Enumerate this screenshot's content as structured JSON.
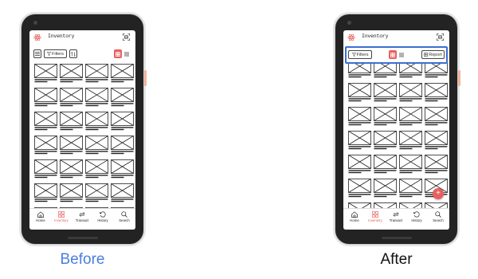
{
  "colors": {
    "accent": "#e85f5f",
    "highlight": "#3c6fd4",
    "caption_before": "#4a7fe0",
    "caption_after": "#111111"
  },
  "before": {
    "caption": "Before",
    "app_title": "Inventory",
    "toolbar": {
      "menu_icon": "menu-icon",
      "filters_label": "Filters",
      "sort_icon": "sort-icon",
      "grid_icon": "grid-view-icon",
      "list_icon": "list-view-icon"
    },
    "nav": [
      {
        "label": "Home",
        "icon": "home-icon"
      },
      {
        "label": "Inventory",
        "icon": "inventory-icon",
        "active": true
      },
      {
        "label": "Transact",
        "icon": "transact-icon"
      },
      {
        "label": "History",
        "icon": "history-icon"
      },
      {
        "label": "Search",
        "icon": "search-icon"
      }
    ]
  },
  "after": {
    "caption": "After",
    "app_title": "Inventory",
    "toolbar": {
      "filters_label": "Filters",
      "grid_icon": "grid-view-icon",
      "list_icon": "list-view-icon",
      "report_label": "Report"
    },
    "fab": "+",
    "nav": [
      {
        "label": "Home",
        "icon": "home-icon"
      },
      {
        "label": "Inventory",
        "icon": "inventory-icon",
        "active": true
      },
      {
        "label": "Transact",
        "icon": "transact-icon"
      },
      {
        "label": "History",
        "icon": "history-icon"
      },
      {
        "label": "Search",
        "icon": "search-icon"
      }
    ]
  }
}
